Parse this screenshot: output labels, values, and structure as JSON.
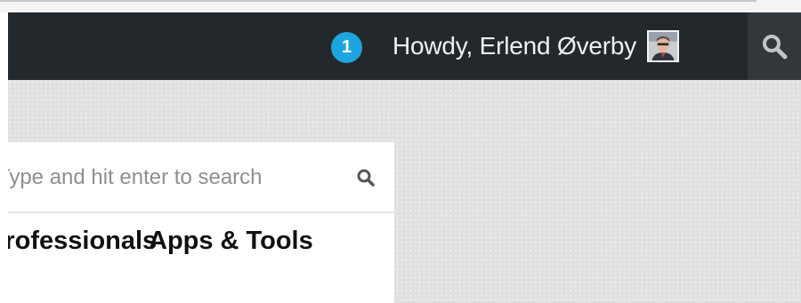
{
  "admin_bar": {
    "notification_count": "1",
    "greeting": "Howdy, Erlend Øverby",
    "avatar_icon": "user-avatar",
    "search_icon": "search-icon"
  },
  "site_search": {
    "placeholder": "Type and hit enter to search",
    "search_icon": "search-icon"
  },
  "menu": {
    "items": [
      {
        "label": "Professionals"
      },
      {
        "label": "Apps & Tools"
      }
    ]
  },
  "colors": {
    "admin_bar_bg": "#23282d",
    "badge_bg": "#1ea5dd",
    "content_bg": "#dfe0e2"
  }
}
